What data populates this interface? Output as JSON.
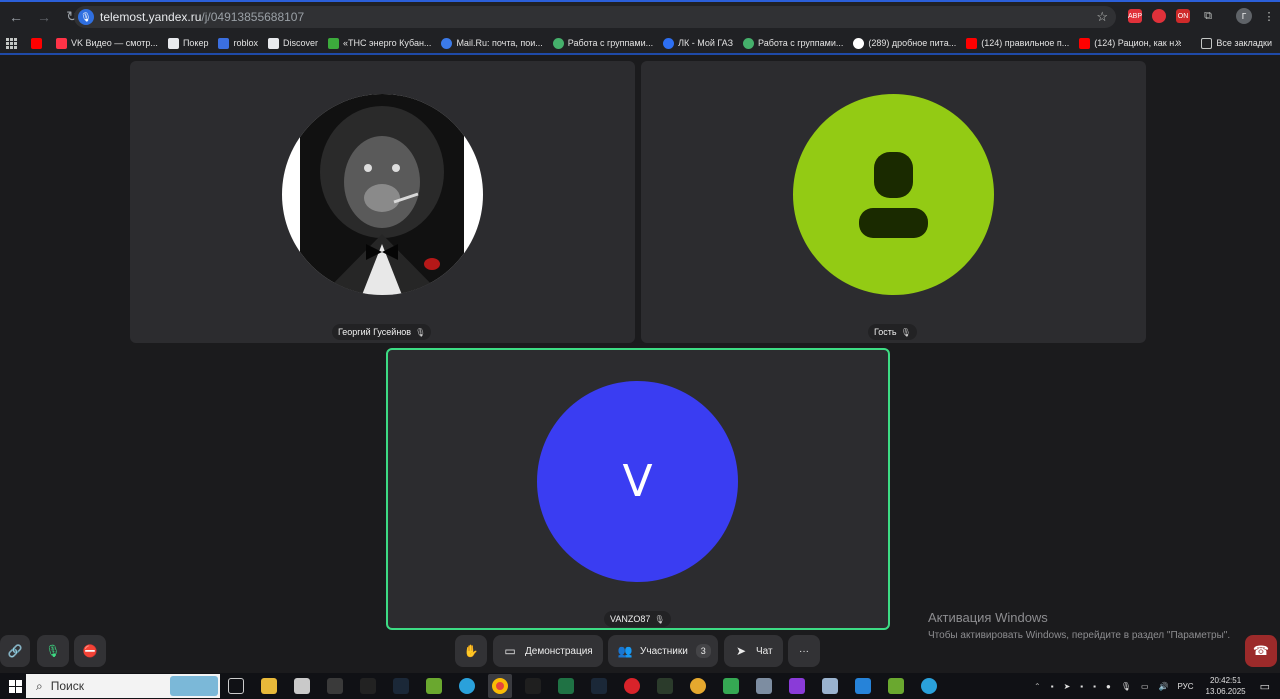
{
  "browser": {
    "url_host": "telemost.yandex.ru",
    "url_path": "/j/04913855688107",
    "extensions": [
      {
        "name": "adblock-icon",
        "label": "ABP",
        "color": "#e0313a"
      },
      {
        "name": "opera-ext-icon",
        "label": "",
        "color": "#e0313a"
      },
      {
        "name": "ext-red-icon",
        "label": "ON",
        "color": "#cf2a2a"
      },
      {
        "name": "puzzle-icon",
        "label": "",
        "color": "#5f6368"
      }
    ],
    "profile_initial": "Г"
  },
  "bookmarks": {
    "items": [
      {
        "label": "",
        "icon": "youtube-icon",
        "color": "#ff0000"
      },
      {
        "label": "VK Видео — смотр...",
        "icon": "vk-video-icon",
        "color": "#ff3347"
      },
      {
        "label": "Покер",
        "icon": "folder-icon",
        "color": "#e8eaed"
      },
      {
        "label": "roblox",
        "icon": "roblox-icon",
        "color": "#3b6fe0"
      },
      {
        "label": "Discover",
        "icon": "discover-icon",
        "color": "#e8eaed"
      },
      {
        "label": "«ТНС энерго Кубан...",
        "icon": "tns-icon",
        "color": "#3cab3c"
      },
      {
        "label": "Mail.Ru: почта, пои...",
        "icon": "mailru-icon",
        "color": "#3b7ae8"
      },
      {
        "label": "Работа с группами...",
        "icon": "group-icon",
        "color": "#45b06b"
      },
      {
        "label": "ЛК - Мой ГАЗ",
        "icon": "gas-icon",
        "color": "#2d6ff2"
      },
      {
        "label": "Работа с группами...",
        "icon": "group-icon",
        "color": "#45b06b"
      },
      {
        "label": "(289) дробное пита...",
        "icon": "google-icon",
        "color": "#ffffff"
      },
      {
        "label": "(124) правильное п...",
        "icon": "youtube-icon",
        "color": "#ff0000"
      },
      {
        "label": "(124) Рацион, как н...",
        "icon": "youtube-icon",
        "color": "#ff0000"
      }
    ],
    "more": "»",
    "all_bookmarks": "Все закладки"
  },
  "participants": [
    {
      "name": "Георгий Гусейнов",
      "avatar": "lion-photo",
      "color": "#ffffff"
    },
    {
      "name": "Гость",
      "avatar": "guest-person-icon",
      "color": "#93cb14"
    },
    {
      "name": "VANZO87",
      "avatar_letter": "V",
      "color": "#3a3df2",
      "speaking_color": "#3ddc84"
    }
  ],
  "watermark": {
    "title": "Активация Windows",
    "subtitle": "Чтобы активировать Windows, перейдите в раздел \"Параметры\"."
  },
  "controls": {
    "demo_label": "Демонстрация",
    "participants_label": "Участники",
    "participants_count": "3",
    "chat_label": "Чат",
    "more_label": "···"
  },
  "taskbar": {
    "search_placeholder": "Поиск",
    "language": "РУС",
    "time": "20:42:51",
    "date": "13.06.2025"
  }
}
